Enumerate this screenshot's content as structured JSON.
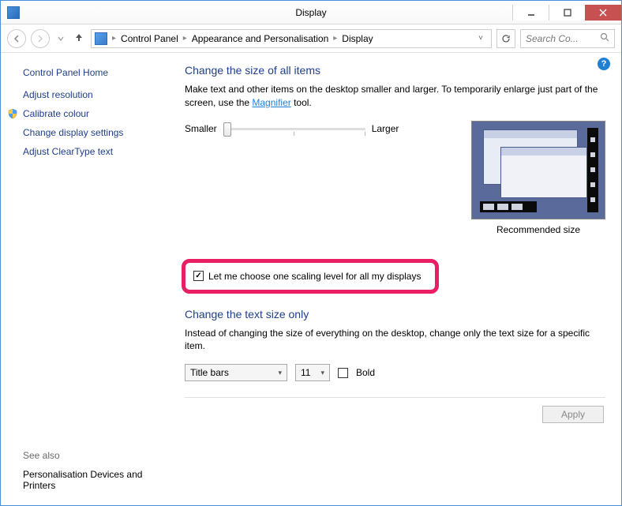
{
  "window": {
    "title": "Display"
  },
  "breadcrumb": {
    "items": [
      "Control Panel",
      "Appearance and Personalisation",
      "Display"
    ]
  },
  "search": {
    "placeholder": "Search Co..."
  },
  "sidebar": {
    "home": "Control Panel Home",
    "links": {
      "adjust_resolution": "Adjust resolution",
      "calibrate_colour": "Calibrate colour",
      "change_settings": "Change display settings",
      "cleartype": "Adjust ClearType text"
    },
    "see_also_header": "See also",
    "see_also": {
      "personalisation": "Personalisation",
      "devices_printers": "Devices and Printers"
    }
  },
  "main": {
    "heading1": "Change the size of all items",
    "desc1_a": "Make text and other items on the desktop smaller and larger. To temporarily enlarge just part of the screen, use the ",
    "desc1_link": "Magnifier",
    "desc1_b": " tool.",
    "slider": {
      "min_label": "Smaller",
      "max_label": "Larger"
    },
    "preview_label": "Recommended size",
    "scaling_checkbox": "Let me choose one scaling level for all my displays",
    "heading2": "Change the text size only",
    "desc2": "Instead of changing the size of everything on the desktop, change only the text size for a specific item.",
    "textsize": {
      "item": "Title bars",
      "size": "11",
      "bold_label": "Bold"
    },
    "apply": "Apply"
  },
  "help": "?"
}
